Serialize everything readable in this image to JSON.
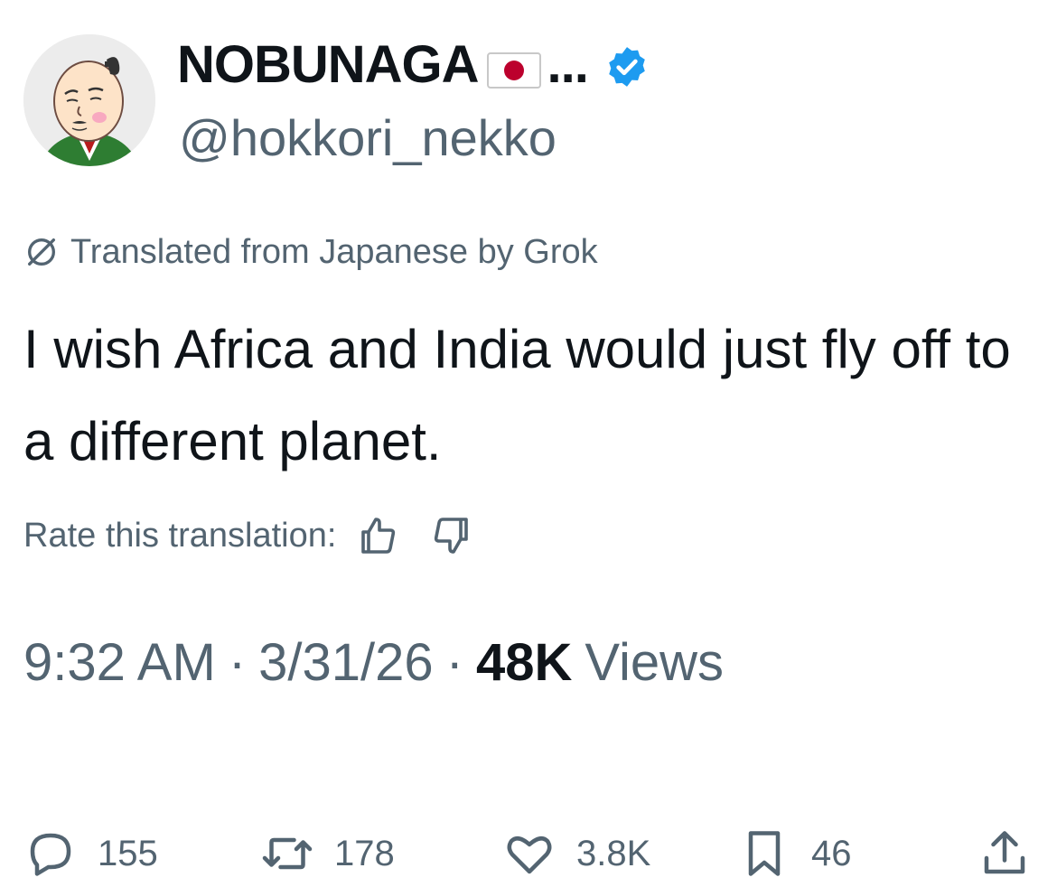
{
  "user": {
    "display_name": "NOBUNAGA",
    "ellipsis": "...",
    "handle": "@hokkori_nekko",
    "flag_icon": "japan-flag-icon",
    "verified_icon": "verified-badge-icon",
    "verified_color": "#1d9bf0"
  },
  "translation": {
    "notice": "Translated from Japanese by Grok",
    "rate_label": "Rate this translation:",
    "icon": "grok-icon"
  },
  "tweet": {
    "text": "I wish Africa and India would just fly off to a different planet."
  },
  "meta": {
    "time": "9:32 AM",
    "separator": "·",
    "date": "3/31/26",
    "views_count": "48K",
    "views_label": "Views"
  },
  "actions": {
    "replies": "155",
    "reposts": "178",
    "likes": "3.8K",
    "bookmarks": "46"
  },
  "colors": {
    "text_primary": "#0f1419",
    "text_secondary": "#536471",
    "accent": "#1d9bf0",
    "flag_red": "#bc002d"
  }
}
